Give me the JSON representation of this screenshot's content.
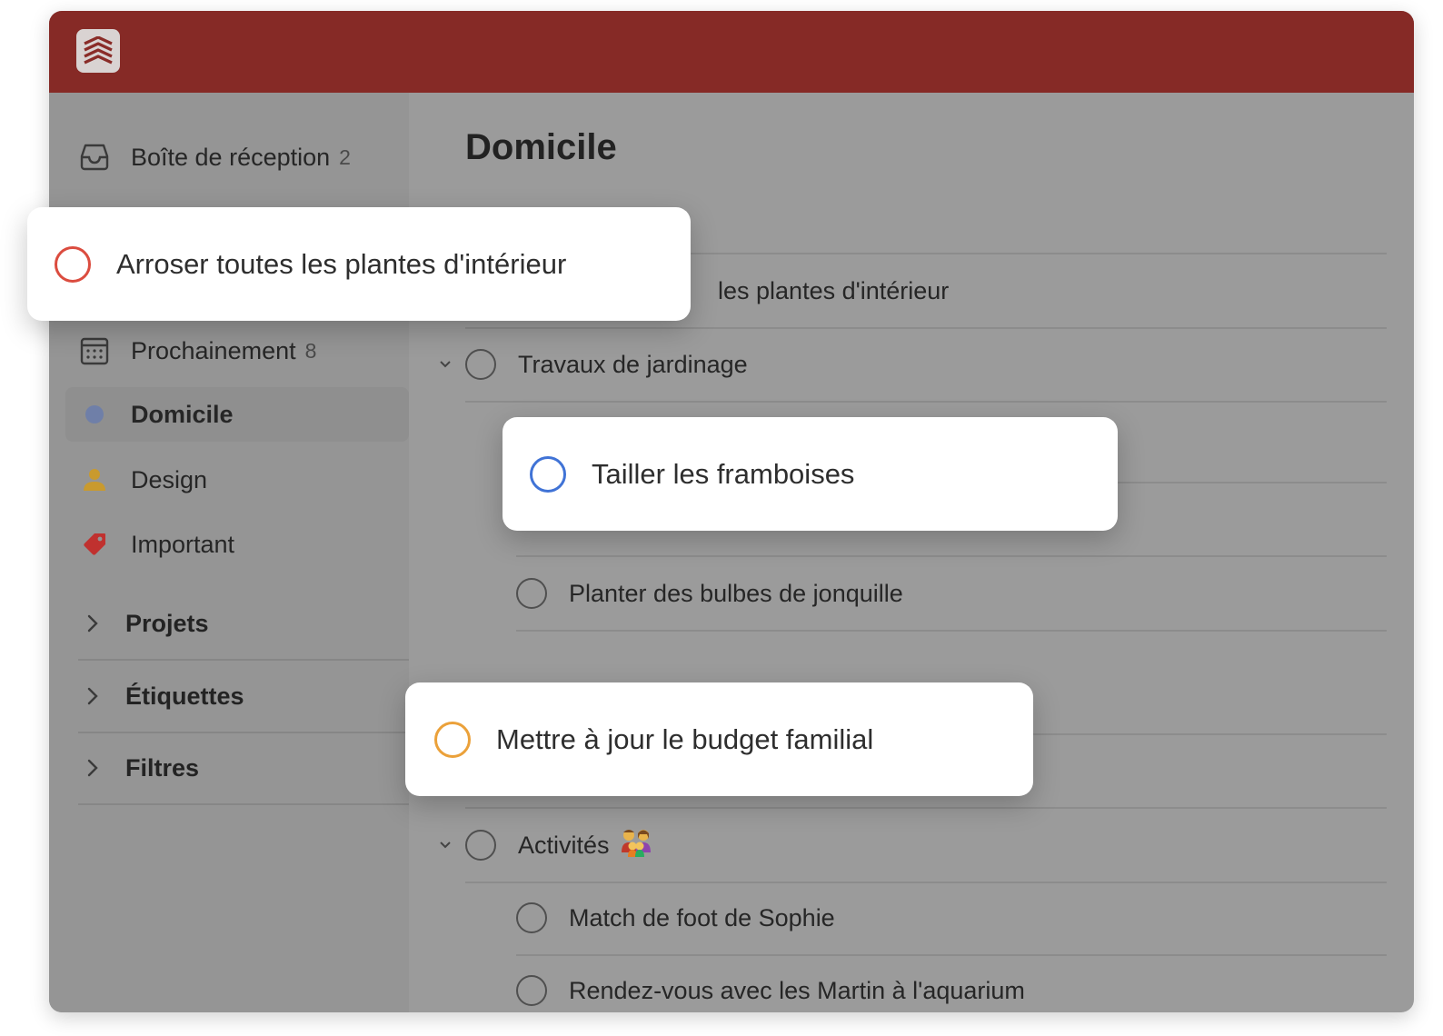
{
  "sidebar": {
    "items": [
      {
        "label": "Boîte de réception",
        "count": "2",
        "icon": "inbox-icon"
      },
      {
        "label": "Prochainement",
        "count": "8",
        "icon": "calendar-icon"
      },
      {
        "label": "Domicile",
        "icon": "project-dot-icon",
        "active": true
      },
      {
        "label": "Design",
        "icon": "person-icon"
      },
      {
        "label": "Important",
        "icon": "tag-icon"
      }
    ],
    "groups": [
      {
        "label": "Projets"
      },
      {
        "label": "Étiquettes"
      },
      {
        "label": "Filtres"
      }
    ]
  },
  "main": {
    "title": "Domicile",
    "tasks": [
      {
        "label": "les plantes d'intérieur"
      },
      {
        "label": "Travaux de jardinage"
      },
      {
        "label": "Planter des bulbes de jonquille"
      },
      {
        "label": "Activités"
      },
      {
        "label": "Match de foot de Sophie"
      },
      {
        "label": "Rendez-vous avec les Martin à l'aquarium"
      }
    ]
  },
  "cards": [
    {
      "label": "Arroser toutes les plantes d'intérieur",
      "color": "#db4c3f"
    },
    {
      "label": "Tailler les framboises",
      "color": "#4073d6"
    },
    {
      "label": "Mettre à jour le budget familial",
      "color": "#eba13a"
    }
  ],
  "colors": {
    "header": "#862a26",
    "project_dot": "#6f7fa8",
    "person_icon": "#c99a2e",
    "tag_icon": "#c0312f"
  }
}
